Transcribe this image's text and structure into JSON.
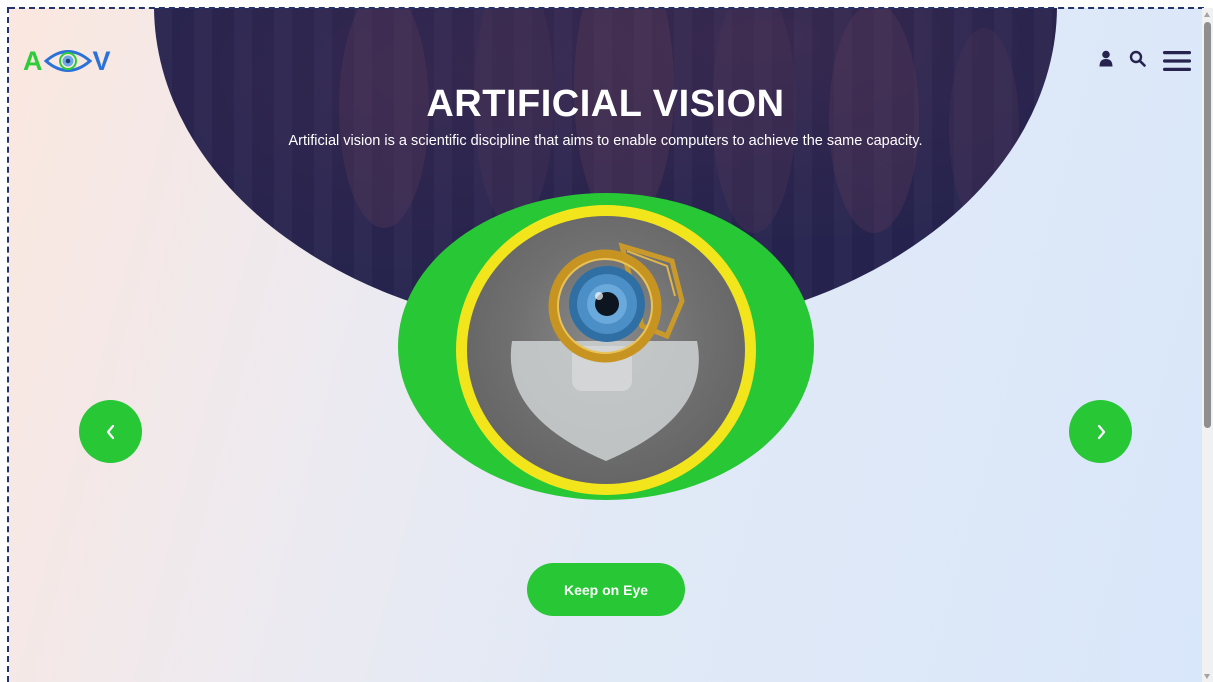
{
  "logo": {
    "letter_left": "A",
    "letter_right": "V",
    "icon": "eye-icon",
    "colors": {
      "left": "#2ecc3a",
      "right": "#2a72d9"
    }
  },
  "header": {
    "icons": [
      "user-icon",
      "search-icon",
      "hamburger-menu-icon"
    ]
  },
  "hero": {
    "title": "ARTIFICIAL VISION",
    "subtitle": "Artificial vision is a scientific discipline that aims to enable computers to achieve the same capacity.",
    "image": "bionic-eye-implant-image",
    "colors": {
      "dome": "#26244f",
      "oval": "#27c736",
      "ring": "#f3e51c"
    }
  },
  "carousel": {
    "prev_icon": "chevron-left-icon",
    "next_icon": "chevron-right-icon"
  },
  "cta": {
    "label": "Keep on Eye",
    "color": "#27c736"
  }
}
